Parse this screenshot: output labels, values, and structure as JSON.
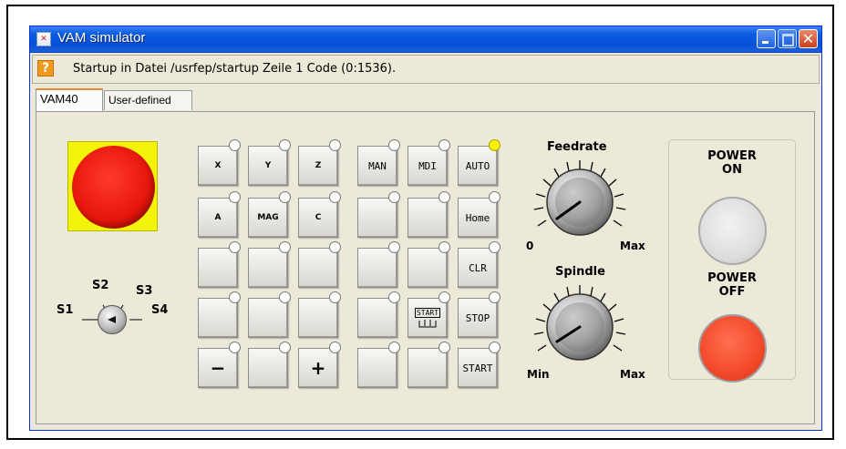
{
  "window": {
    "title": "VAM simulator",
    "app_icon": "simulator-icon",
    "controls": [
      "minimize-icon",
      "maximize-icon",
      "close-icon"
    ]
  },
  "status": {
    "icon": "?",
    "text": "Startup in Datei /usrfep/startup Zeile 1 Code (0:1536)."
  },
  "tabs": [
    {
      "label": "VAM40",
      "active": true
    },
    {
      "label": "User-defined",
      "active": false
    }
  ],
  "selector": {
    "labels": {
      "s1": "S1",
      "s2": "S2",
      "s3": "S3",
      "s4": "S4"
    }
  },
  "axis_keys": {
    "r1": [
      "X",
      "Y",
      "Z"
    ],
    "r2": [
      "A",
      "MAG",
      "C"
    ],
    "r3": [
      "",
      "",
      ""
    ],
    "r4": [
      "",
      "",
      ""
    ],
    "r5": [
      "−",
      "",
      "+"
    ]
  },
  "mode_keys": {
    "r1": [
      "MAN",
      "MDI",
      "AUTO"
    ],
    "r2": [
      "",
      "",
      "Home"
    ],
    "r3": [
      "",
      "",
      "CLR"
    ],
    "r4": [
      "",
      "",
      "STOP"
    ],
    "r5": [
      "",
      "",
      "START"
    ],
    "start_glyph": "START",
    "active_led": "AUTO",
    "led_on_color": "#fff200"
  },
  "feedrate": {
    "title": "Feedrate",
    "min": "0",
    "max": "Max"
  },
  "spindle": {
    "title": "Spindle",
    "min": "Min",
    "max": "Max"
  },
  "power": {
    "on": "POWER ON",
    "off": "POWER OFF",
    "on_l1": "POWER",
    "on_l2": "ON",
    "off_l1": "POWER",
    "off_l2": "OFF"
  },
  "colors": {
    "estop": "#e6160b",
    "estop_base": "#f4f40a",
    "power_off": "#f2492a",
    "power_on": "#dcdcdc",
    "titlebar": "#0650d6"
  }
}
